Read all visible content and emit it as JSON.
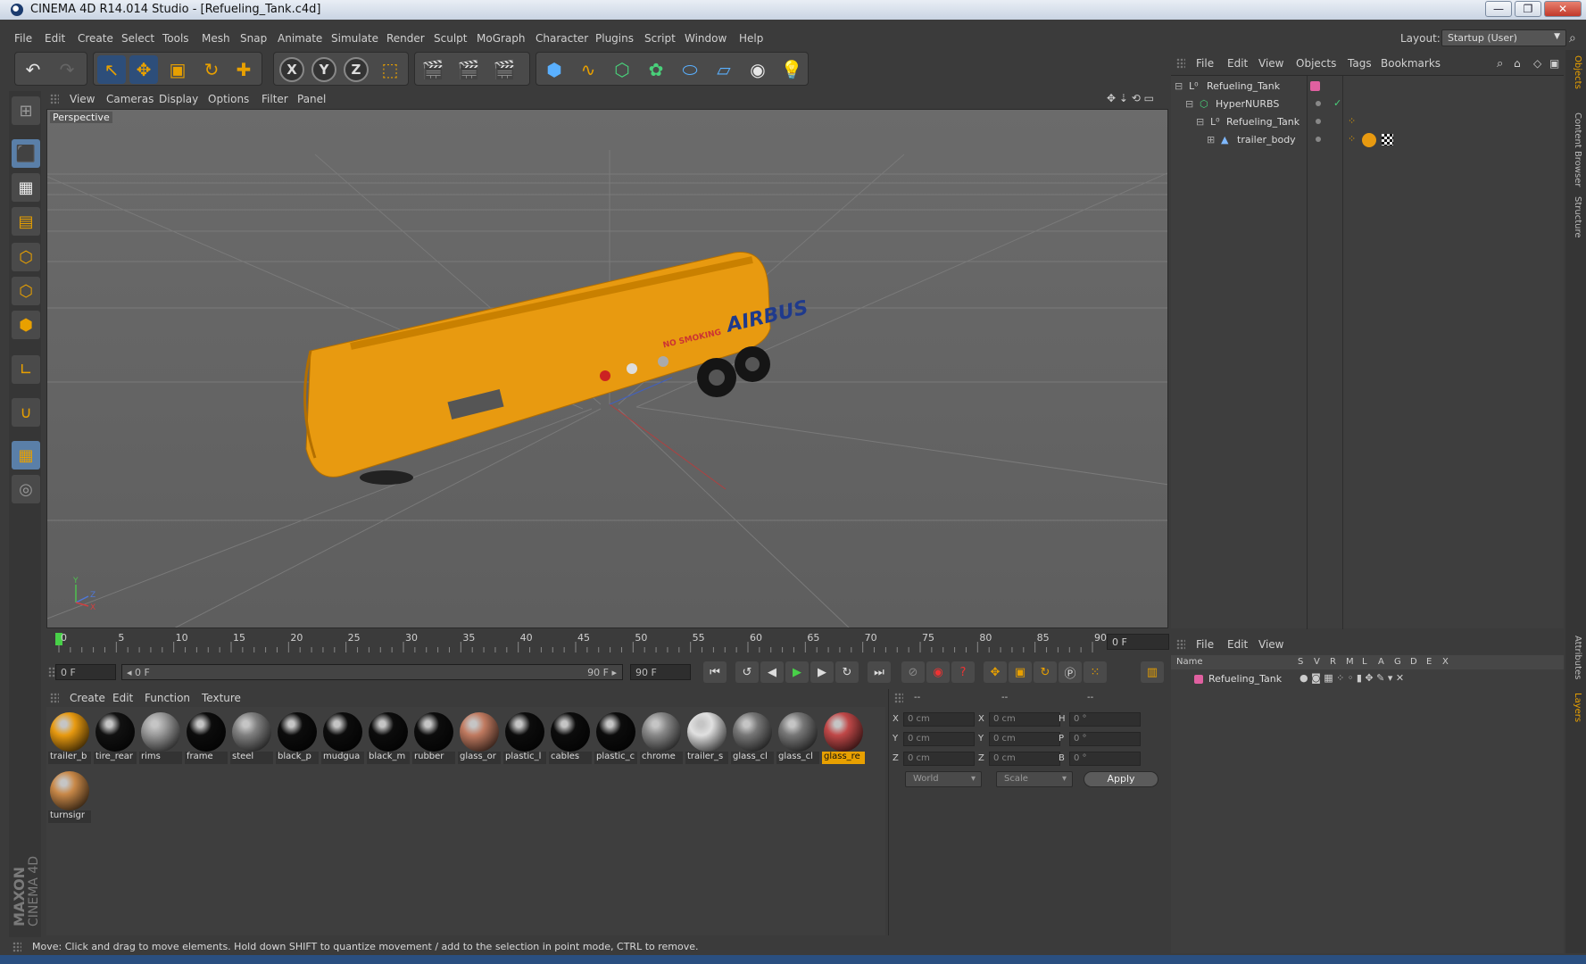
{
  "window": {
    "title": "CINEMA 4D R14.014 Studio - [Refueling_Tank.c4d]",
    "buttons": {
      "minimize": "—",
      "restore": "❐",
      "close": "✕"
    }
  },
  "menu": [
    "File",
    "Edit",
    "Create",
    "Select",
    "Tools",
    "Mesh",
    "Snap",
    "Animate",
    "Simulate",
    "Render",
    "Sculpt",
    "MoGraph",
    "Character",
    "Plugins",
    "Script",
    "Window",
    "Help"
  ],
  "layout": {
    "label": "Layout:",
    "value": "Startup (User)"
  },
  "viewport": {
    "menu": [
      "View",
      "Cameras",
      "Display",
      "Options",
      "Filter",
      "Panel"
    ],
    "label": "Perspective",
    "tank_text": "AIRBUS",
    "tank_warning": "NO SMOKING",
    "axis_y": "Y",
    "axis_z": "Z",
    "axis_x": "X"
  },
  "timeline": {
    "ticks": [
      "0",
      "5",
      "10",
      "15",
      "20",
      "25",
      "30",
      "35",
      "40",
      "45",
      "50",
      "55",
      "60",
      "65",
      "70",
      "75",
      "80",
      "85",
      "90"
    ],
    "current_frame": "0 F",
    "start_field": "0 F",
    "range_start": "◂ 0 F",
    "range_end": "90 F ▸",
    "end_field": "90 F"
  },
  "materials": {
    "menu": [
      "Create",
      "Edit",
      "Function",
      "Texture"
    ],
    "items": [
      {
        "name": "trailer_b",
        "color": "#e89a10"
      },
      {
        "name": "tire_rear",
        "color": "#111111"
      },
      {
        "name": "rims",
        "color": "#9a9a9a"
      },
      {
        "name": "frame",
        "color": "#0c0c0c"
      },
      {
        "name": "steel",
        "color": "#808080"
      },
      {
        "name": "black_p",
        "color": "#0c0c0c"
      },
      {
        "name": "mudgua",
        "color": "#0c0c0c"
      },
      {
        "name": "black_m",
        "color": "#0c0c0c"
      },
      {
        "name": "rubber",
        "color": "#0c0c0c"
      },
      {
        "name": "glass_or",
        "color": "#c07a60"
      },
      {
        "name": "plastic_l",
        "color": "#0c0c0c"
      },
      {
        "name": "cables",
        "color": "#0c0c0c"
      },
      {
        "name": "plastic_c",
        "color": "#0c0c0c"
      },
      {
        "name": "chrome",
        "color": "#888888"
      },
      {
        "name": "trailer_s",
        "color": "#e0e0e0"
      },
      {
        "name": "glass_cl",
        "color": "#777777"
      },
      {
        "name": "glass_cl",
        "color": "#777777"
      },
      {
        "name": "glass_re",
        "color": "#c04848"
      },
      {
        "name": "turnsigr",
        "color": "#c88848"
      }
    ]
  },
  "coordinates": {
    "headers": [
      "--",
      "--",
      "--"
    ],
    "rows": [
      {
        "a": "X",
        "av": "0 cm",
        "b": "X",
        "bv": "0 cm",
        "c": "H",
        "cv": "0 °"
      },
      {
        "a": "Y",
        "av": "0 cm",
        "b": "Y",
        "bv": "0 cm",
        "c": "P",
        "cv": "0 °"
      },
      {
        "a": "Z",
        "av": "0 cm",
        "b": "Z",
        "bv": "0 cm",
        "c": "B",
        "cv": "0 °"
      }
    ],
    "mode": "World",
    "type": "Scale",
    "apply": "Apply"
  },
  "objects": {
    "menu": [
      "File",
      "Edit",
      "View",
      "Objects",
      "Tags",
      "Bookmarks"
    ],
    "tree": [
      {
        "label": "Refueling_Tank",
        "indent": 0
      },
      {
        "label": "HyperNURBS",
        "indent": 1
      },
      {
        "label": "Refueling_Tank",
        "indent": 2
      },
      {
        "label": "trailer_body",
        "indent": 3
      }
    ]
  },
  "layers": {
    "menu": [
      "File",
      "Edit",
      "View"
    ],
    "columns": [
      "Name",
      "S",
      "V",
      "R",
      "M",
      "L",
      "A",
      "G",
      "D",
      "E",
      "X"
    ],
    "rows": [
      {
        "name": "Refueling_Tank",
        "color": "#e060a0"
      }
    ]
  },
  "sidetabs": [
    "Objects",
    "Content Browser",
    "Structure",
    "Attributes",
    "Layers"
  ],
  "status": "Move: Click and drag to move elements. Hold down SHIFT to quantize movement / add to the selection in point mode, CTRL to remove.",
  "brand": {
    "maxon": "MAXON",
    "cinema": "CINEMA 4D"
  },
  "colors": {
    "accent": "#e8a000",
    "selection": "#5a7fa8"
  }
}
